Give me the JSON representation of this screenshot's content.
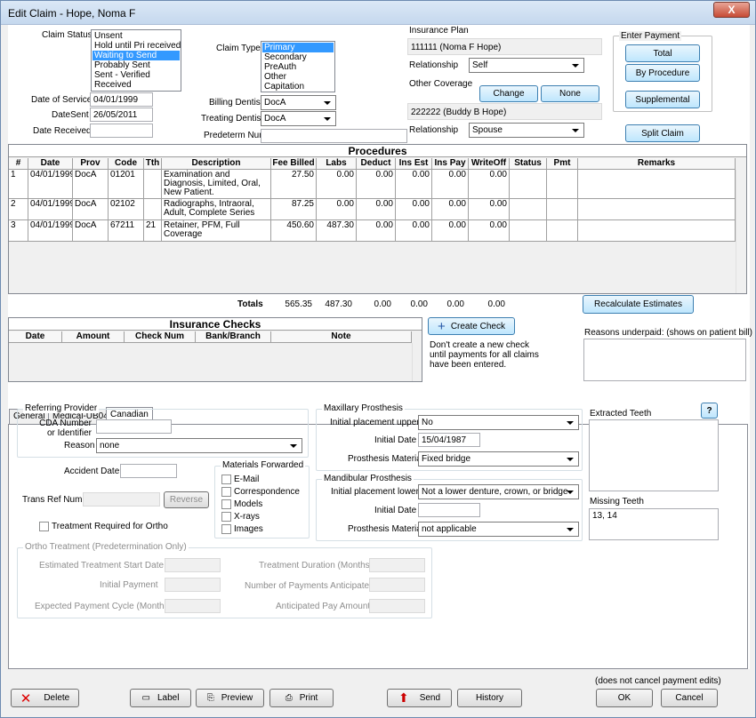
{
  "window": {
    "title": "Edit Claim - Hope, Noma F",
    "close": "X"
  },
  "claim_status": {
    "label": "Claim Status",
    "options": [
      "Unsent",
      "Hold until Pri received",
      "Waiting to Send",
      "Probably Sent",
      "Sent - Verified",
      "Received"
    ],
    "selected": "Waiting to Send"
  },
  "claim_type": {
    "label": "Claim Type",
    "options": [
      "Primary",
      "Secondary",
      "PreAuth",
      "Other",
      "Capitation"
    ],
    "selected": "Primary"
  },
  "dates": {
    "service_label": "Date of Service",
    "service": "04/01/1999",
    "sent_label": "DateSent",
    "sent": "26/05/2011",
    "received_label": "Date Received",
    "received": ""
  },
  "dentists": {
    "billing_label": "Billing Dentist",
    "billing": "DocA",
    "treating_label": "Treating Dentist",
    "treating": "DocA",
    "predeterm_label": "Predeterm Num",
    "predeterm": ""
  },
  "insurance": {
    "plan_label": "Insurance Plan",
    "plan": "111111 (Noma F Hope)",
    "relationship_label": "Relationship",
    "relationship": "Self",
    "other_label": "Other Coverage",
    "change": "Change",
    "none": "None",
    "other_plan": "222222 (Buddy B Hope)",
    "other_relationship": "Spouse"
  },
  "payment": {
    "title": "Enter Payment",
    "total": "Total",
    "by_procedure": "By Procedure",
    "supplemental": "Supplemental",
    "split": "Split Claim"
  },
  "procedures": {
    "title": "Procedures",
    "columns": [
      "#",
      "Date",
      "Prov",
      "Code",
      "Tth",
      "Description",
      "Fee Billed",
      "Labs",
      "Deduct",
      "Ins Est",
      "Ins Pay",
      "WriteOff",
      "Status",
      "Pmt",
      "Remarks"
    ],
    "rows": [
      [
        "1",
        "04/01/1999",
        "DocA",
        "01201",
        "",
        "Examination and Diagnosis, Limited, Oral, New Patient.",
        "27.50",
        "0.00",
        "0.00",
        "0.00",
        "0.00",
        "0.00",
        "",
        "",
        ""
      ],
      [
        "2",
        "04/01/1999",
        "DocA",
        "02102",
        "",
        "Radiographs, Intraoral, Adult, Complete Series",
        "87.25",
        "0.00",
        "0.00",
        "0.00",
        "0.00",
        "0.00",
        "",
        "",
        ""
      ],
      [
        "3",
        "04/01/1999",
        "DocA",
        "67211",
        "21",
        "Retainer, PFM, Full Coverage",
        "450.60",
        "487.30",
        "0.00",
        "0.00",
        "0.00",
        "0.00",
        "",
        "",
        ""
      ]
    ],
    "totals_label": "Totals",
    "totals": [
      "565.35",
      "487.30",
      "0.00",
      "0.00",
      "0.00",
      "0.00"
    ]
  },
  "recalc": "Recalculate Estimates",
  "checks": {
    "title": "Insurance Checks",
    "columns": [
      "Date",
      "Amount",
      "Check Num",
      "Bank/Branch",
      "Note"
    ],
    "create": "Create Check",
    "note": "Don't create a new check until payments for all claims have been entered."
  },
  "reasons": {
    "label": "Reasons underpaid:  (shows on patient bill)",
    "value": ""
  },
  "tabs": [
    "General",
    "Medical-UB04",
    "Canadian"
  ],
  "canadian": {
    "referring": {
      "title": "Referring Provider",
      "cda_label": "CDA Number or Identifier",
      "cda_label1": "CDA Number",
      "cda_label2": "or Identifier",
      "cda": "",
      "reason_label": "Reason",
      "reason": "none"
    },
    "accident_label": "Accident Date",
    "accident": "",
    "trans_label": "Trans Ref Num",
    "trans": "",
    "reverse": "Reverse",
    "ortho_required": "Treatment Required for Ortho",
    "materials": {
      "title": "Materials Forwarded",
      "items": [
        "E-Mail",
        "Correspondence",
        "Models",
        "X-rays",
        "Images"
      ]
    },
    "maxillary": {
      "title": "Maxillary Prosthesis",
      "initial_label": "Initial placement upper?",
      "initial": "No",
      "date_label": "Initial Date",
      "date": "15/04/1987",
      "material_label": "Prosthesis Material",
      "material": "Fixed bridge"
    },
    "mandibular": {
      "title": "Mandibular Prosthesis",
      "initial_label": "Initial placement lower?",
      "initial": "Not a lower denture, crown, or bridge",
      "date_label": "Initial Date",
      "date": "",
      "material_label": "Prosthesis Material",
      "material": "not applicable"
    },
    "extracted": {
      "label": "Extracted Teeth",
      "help": "?",
      "value": ""
    },
    "missing": {
      "label": "Missing Teeth",
      "value": "13, 14"
    },
    "ortho": {
      "title": "Ortho Treatment (Predetermination Only)",
      "start_label": "Estimated Treatment Start Date",
      "initial_label": "Initial Payment",
      "cycle_label": "Expected Payment Cycle (Months)",
      "duration_label": "Treatment Duration (Months)",
      "payments_label": "Number of Payments Anticipated",
      "amount_label": "Anticipated Pay Amount"
    }
  },
  "footer": {
    "note": "(does not cancel payment edits)",
    "delete": "Delete",
    "label": "Label",
    "preview": "Preview",
    "print": "Print",
    "send": "Send",
    "history": "History",
    "ok": "OK",
    "cancel": "Cancel"
  }
}
